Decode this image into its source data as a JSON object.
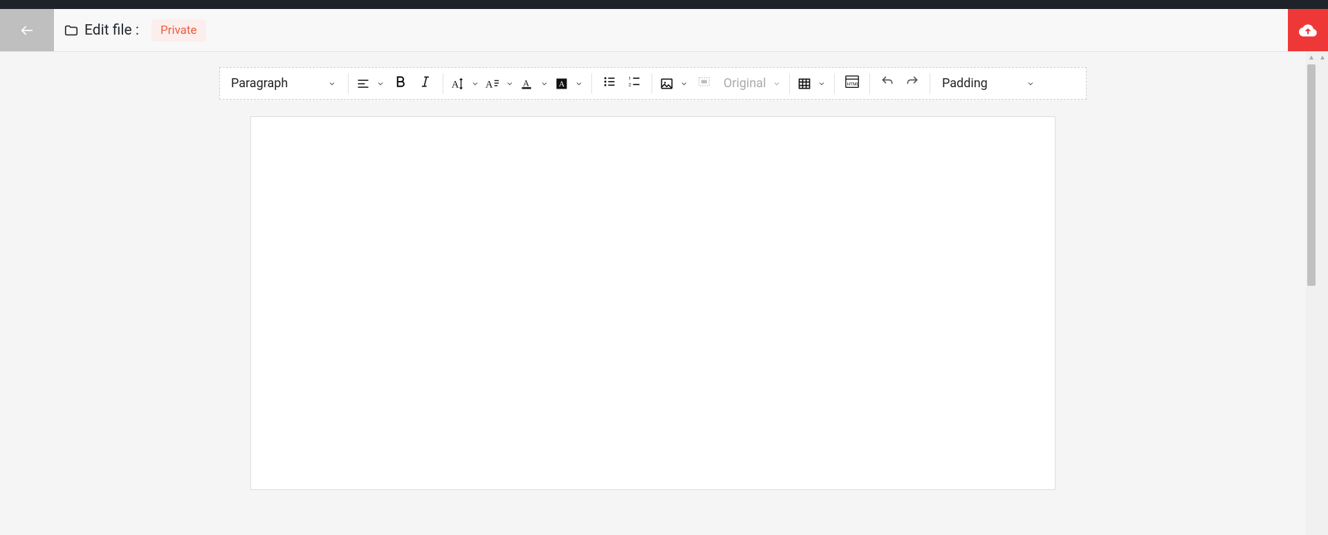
{
  "header": {
    "title": "Edit file :",
    "badge": "Private"
  },
  "toolbar": {
    "paragraph": "Paragraph",
    "original": "Original",
    "padding": "Padding"
  },
  "colors": {
    "accent_red": "#ee3837",
    "badge_bg": "#fceeec",
    "badge_text": "#e85d3e"
  }
}
